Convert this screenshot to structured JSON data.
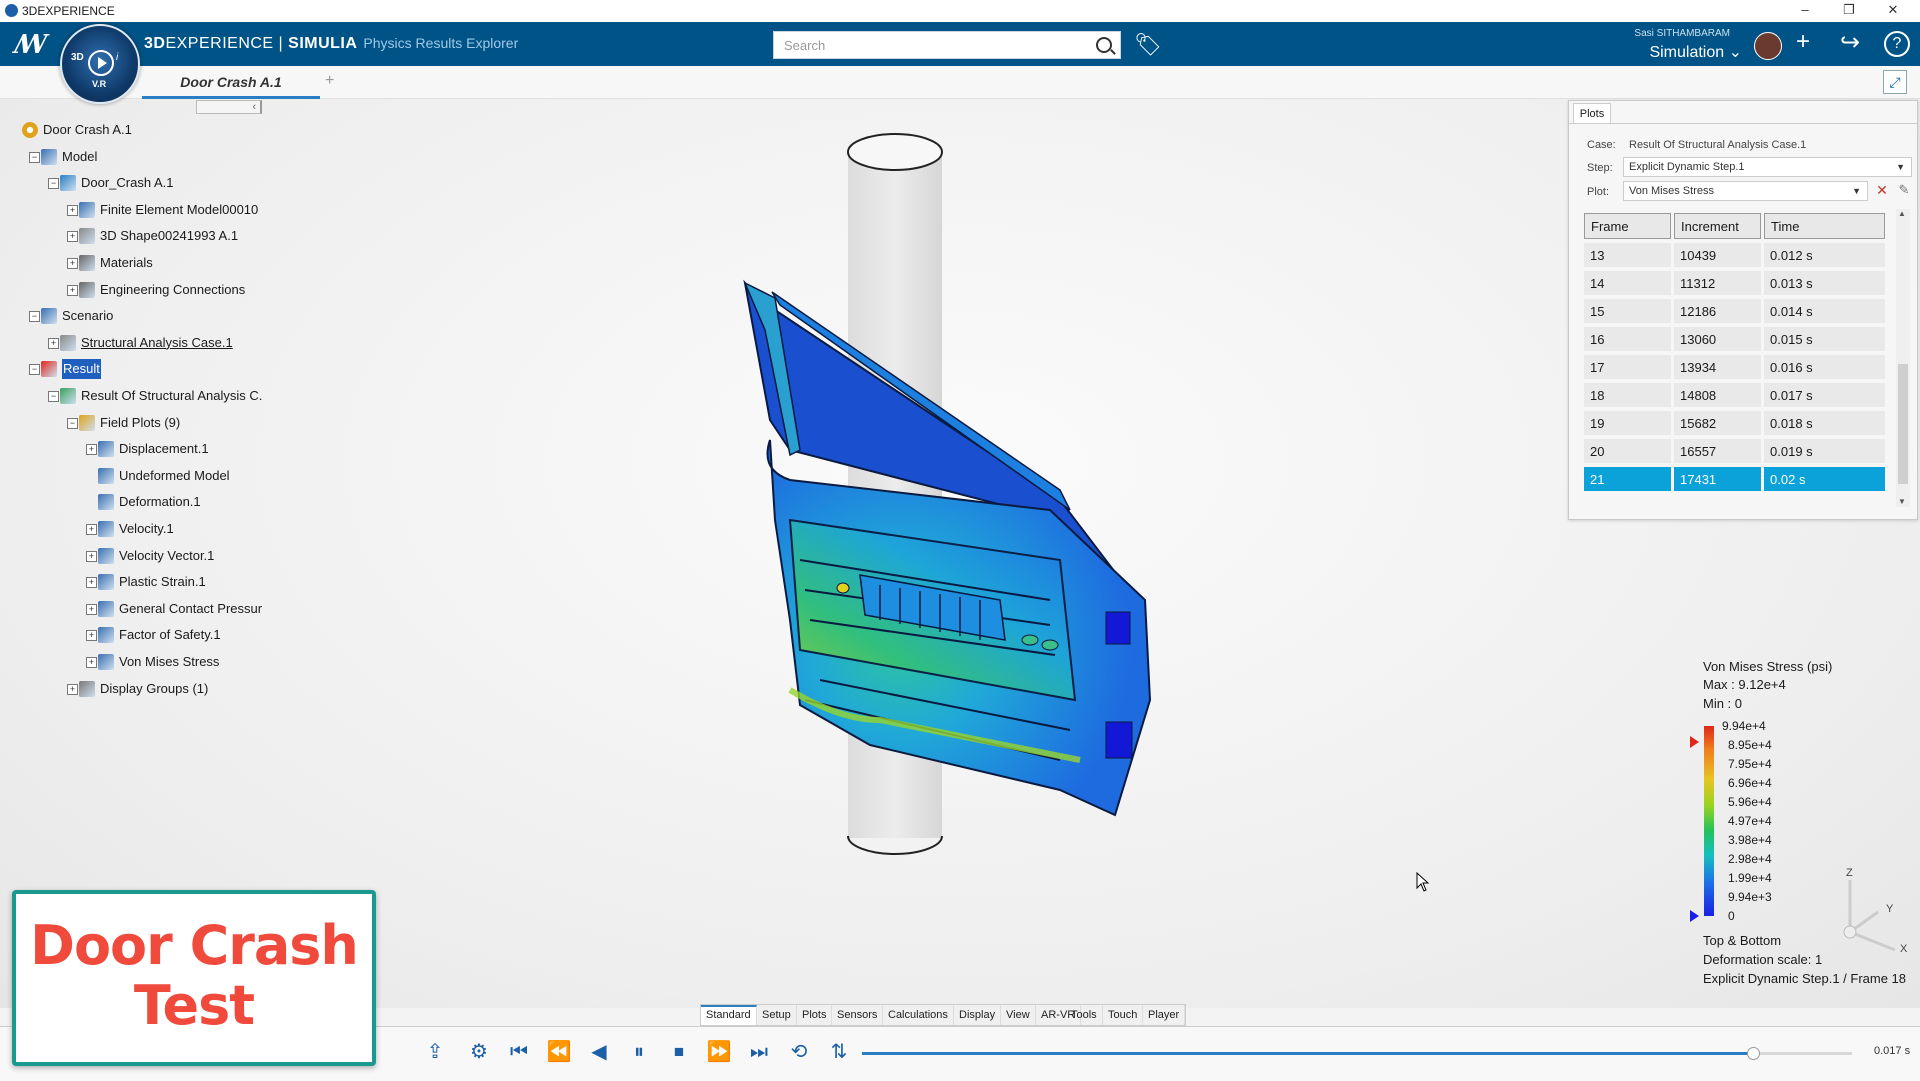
{
  "os_bar": {
    "title": "3DEXPERIENCE",
    "minimize": "–",
    "restore": "❐",
    "close": "✕"
  },
  "header": {
    "app_name_bold": "3D",
    "app_name_rest": "EXPERIENCE | ",
    "brand_bold": "SIMULIA",
    "app_subtitle": "Physics Results Explorer",
    "compass_3d": "3D",
    "compass_vr": "V.R",
    "compass_i": "i",
    "search_placeholder": "Search",
    "user_name": "Sasi SITHAMBARAM",
    "role": "Simulation",
    "role_chevron": "⌄",
    "plus_glyph": "+",
    "share_glyph": "↪",
    "help_glyph": "?",
    "tag_glyph": "🏷"
  },
  "tabs": {
    "active": "Door Crash A.1",
    "add": "+"
  },
  "tree": {
    "collapse_glyph": "‹",
    "items": [
      {
        "label": "Door Crash A.1"
      },
      {
        "label": "Model"
      },
      {
        "label": "Door_Crash A.1"
      },
      {
        "label": "Finite Element Model00010"
      },
      {
        "label": "3D Shape00241993 A.1"
      },
      {
        "label": "Materials"
      },
      {
        "label": "Engineering Connections"
      },
      {
        "label": "Scenario"
      },
      {
        "label": "Structural Analysis Case.1"
      },
      {
        "label": "Result"
      },
      {
        "label": "Result Of Structural Analysis C."
      },
      {
        "label": "Field Plots (9)"
      },
      {
        "label": "Displacement.1"
      },
      {
        "label": "Undeformed Model"
      },
      {
        "label": "Deformation.1"
      },
      {
        "label": "Velocity.1"
      },
      {
        "label": "Velocity Vector.1"
      },
      {
        "label": "Plastic Strain.1"
      },
      {
        "label": "General Contact Pressur"
      },
      {
        "label": "Factor of Safety.1"
      },
      {
        "label": "Von Mises Stress"
      },
      {
        "label": "Display Groups (1)"
      }
    ]
  },
  "plots_panel": {
    "tab": "Plots",
    "case_label": "Case:",
    "case_value": "Result Of Structural Analysis Case.1",
    "step_label": "Step:",
    "step_value": "Explicit Dynamic Step.1",
    "plot_label": "Plot:",
    "plot_value": "Von Mises Stress",
    "columns": [
      "Frame",
      "Increment",
      "Time"
    ],
    "rows": [
      [
        "13",
        "10439",
        "0.012 s"
      ],
      [
        "14",
        "11312",
        "0.013 s"
      ],
      [
        "15",
        "12186",
        "0.014 s"
      ],
      [
        "16",
        "13060",
        "0.015 s"
      ],
      [
        "17",
        "13934",
        "0.016 s"
      ],
      [
        "18",
        "14808",
        "0.017 s"
      ],
      [
        "19",
        "15682",
        "0.018 s"
      ],
      [
        "20",
        "16557",
        "0.019 s"
      ],
      [
        "21",
        "17431",
        "0.02 s"
      ]
    ],
    "selected_row": 8,
    "dropdown_glyph": "▼",
    "scroll_up": "▲",
    "scroll_down": "▼"
  },
  "legend": {
    "title": "Von Mises Stress (psi)",
    "max": "Max : 9.12e+4",
    "min": "Min : 0",
    "ticks": [
      "9.94e+4",
      "8.95e+4",
      "7.95e+4",
      "6.96e+4",
      "5.96e+4",
      "4.97e+4",
      "3.98e+4",
      "2.98e+4",
      "1.99e+4",
      "9.94e+3",
      "0"
    ],
    "info1": "Top & Bottom",
    "info2": "Deformation scale: 1",
    "info3": "Explicit Dynamic Step.1 / Frame 18",
    "colors": {
      "high": "#e0261c",
      "low": "#1b1fe5"
    }
  },
  "axis": {
    "z": "Z",
    "y": "Y",
    "x": "X"
  },
  "command_tabs": [
    "Standard",
    "Setup",
    "Plots",
    "Sensors",
    "Calculations",
    "Display",
    "View",
    "AR-VR",
    "Tools",
    "Touch",
    "Player"
  ],
  "active_command_tab": "Standard",
  "player": {
    "icons": [
      "export-icon",
      "settings-icon",
      "first-frame-icon",
      "previous-frame-icon",
      "play-reverse-icon",
      "pause-icon",
      "stop-icon",
      "next-frame-icon",
      "last-frame-icon",
      "loop-icon",
      "sort-icon"
    ],
    "progress_fraction": 0.9,
    "time": "0.017 s"
  },
  "overlay": {
    "line1": "Door Crash",
    "line2": "Test"
  },
  "colors": {
    "header_bg": "#005386",
    "accent": "#0aa2d9",
    "overlay_text": "#ef4a3c",
    "overlay_border": "#1a9a8e"
  }
}
